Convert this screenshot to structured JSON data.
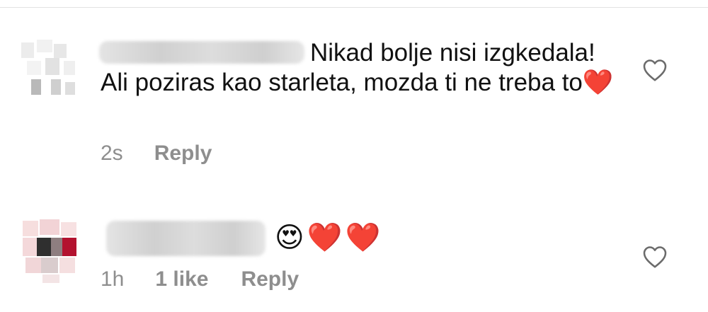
{
  "comments": [
    {
      "text_line1": "Nikad bolje nisi",
      "text_rest": "izgkedala! Ali poziras kao starleta, mozda ti ne treba to",
      "emoji_end": "❤️",
      "time": "2s",
      "reply_label": "Reply",
      "icons": {
        "like": "heart-outline-icon"
      }
    },
    {
      "emojis": [
        "😍",
        "❤️",
        "❤️"
      ],
      "time": "1h",
      "likes": "1 like",
      "reply_label": "Reply",
      "icons": {
        "like": "heart-outline-icon"
      }
    }
  ],
  "colors": {
    "text": "#111111",
    "meta": "#8e8e8e",
    "heart": "#e8112d",
    "divider": "#e3e3e3"
  }
}
